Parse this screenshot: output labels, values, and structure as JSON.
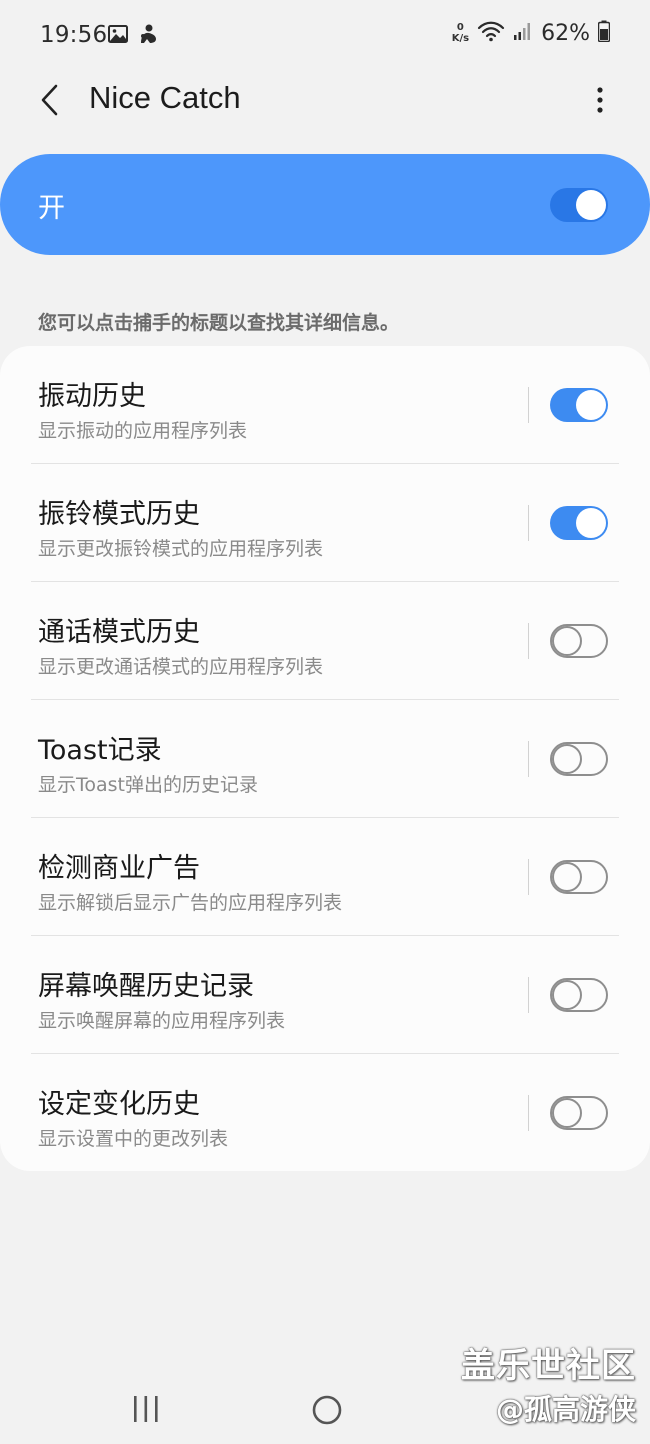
{
  "status_bar": {
    "time": "19:56",
    "net_speed_value": "0",
    "net_speed_unit": "K/s",
    "battery": "62%"
  },
  "header": {
    "title": "Nice Catch",
    "back_icon": "chevron-left-icon",
    "more_icon": "more-vertical-icon"
  },
  "master_switch": {
    "label": "开",
    "on": true
  },
  "info_text": "您可以点击捕手的标题以查找其详细信息。",
  "settings": [
    {
      "title": "振动历史",
      "subtitle": "显示振动的应用程序列表",
      "on": true
    },
    {
      "title": "振铃模式历史",
      "subtitle": "显示更改振铃模式的应用程序列表",
      "on": true
    },
    {
      "title": "通话模式历史",
      "subtitle": "显示更改通话模式的应用程序列表",
      "on": false
    },
    {
      "title": "Toast记录",
      "subtitle": "显示Toast弹出的历史记录",
      "on": false
    },
    {
      "title": "检测商业广告",
      "subtitle": "显示解锁后显示广告的应用程序列表",
      "on": false
    },
    {
      "title": "屏幕唤醒历史记录",
      "subtitle": "显示唤醒屏幕的应用程序列表",
      "on": false
    },
    {
      "title": "设定变化历史",
      "subtitle": "显示设置中的更改列表",
      "on": false
    }
  ],
  "watermark": {
    "line1": "盖乐世社区",
    "line2": "@孤高游侠"
  },
  "colors": {
    "accent": "#4d97fb",
    "toggle_on": "#3d8bf1",
    "background": "#f2f2f2"
  }
}
